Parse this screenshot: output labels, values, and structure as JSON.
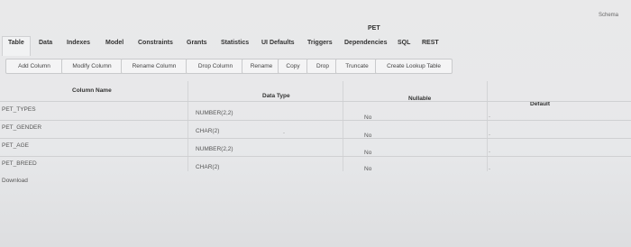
{
  "header": {
    "schema_label": "Schema",
    "object_title": "PET"
  },
  "tabs": [
    "Table",
    "Data",
    "Indexes",
    "Model",
    "Constraints",
    "Grants",
    "Statistics",
    "UI Defaults",
    "Triggers",
    "Dependencies",
    "SQL",
    "REST"
  ],
  "toolbar": [
    "Add Column",
    "Modify Column",
    "Rename Column",
    "Drop Column",
    "Rename",
    "Copy",
    "Drop",
    "Truncate",
    "Create Lookup Table"
  ],
  "columns": [
    "Column Name",
    "Data Type",
    "Nullable",
    "Default"
  ],
  "rows": [
    {
      "name": "PET_TYPES",
      "type": "NUMBER(2,2)",
      "nullable": "No"
    },
    {
      "name": "PET_GENDER",
      "type": "CHAR(2)",
      "nullable": "No"
    },
    {
      "name": "PET_AGE",
      "type": "NUMBER(2,2)",
      "nullable": "No"
    },
    {
      "name": "PET_BREED",
      "type": "CHAR(2)",
      "nullable": "No"
    }
  ],
  "download_label": "Download"
}
